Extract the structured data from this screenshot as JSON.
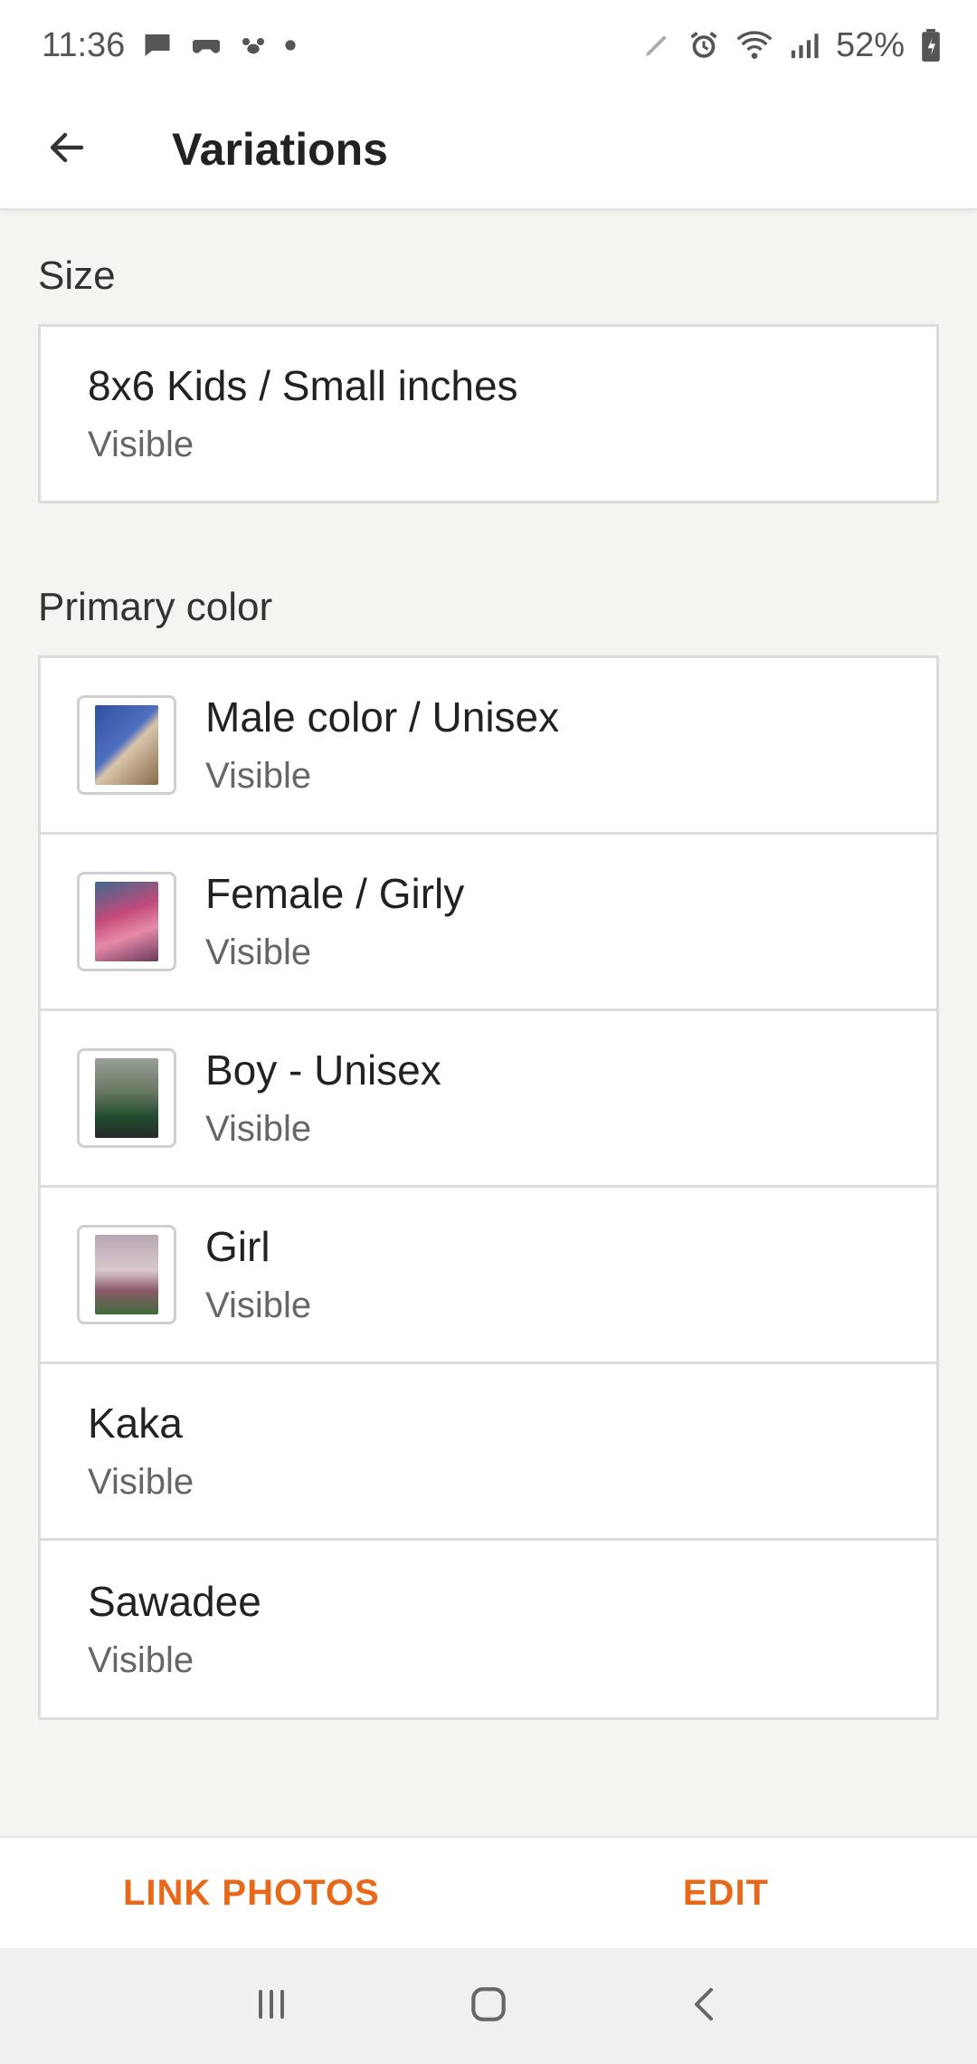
{
  "status_bar": {
    "time": "11:36",
    "battery": "52%",
    "left_icons": [
      "message-icon",
      "game-icon",
      "paw-icon",
      "dot-icon"
    ],
    "right_icons": [
      "pen-icon",
      "alarm-icon",
      "wifi-icon",
      "signal-icon",
      "battery-icon"
    ]
  },
  "app_bar": {
    "title": "Variations",
    "back_icon": "arrow-left-icon"
  },
  "sections": {
    "size": {
      "label": "Size",
      "items": [
        {
          "title": "8x6 Kids / Small inches",
          "status": "Visible"
        }
      ]
    },
    "primary_color": {
      "label": "Primary color",
      "items": [
        {
          "title": "Male color / Unisex",
          "status": "Visible",
          "thumb_colors": [
            "#2f4fa0",
            "#d7c4a8"
          ]
        },
        {
          "title": "Female / Girly",
          "status": "Visible",
          "thumb_colors": [
            "#c24a7a",
            "#3b6a8e"
          ]
        },
        {
          "title": "Boy - Unisex",
          "status": "Visible",
          "thumb_colors": [
            "#6b7a63",
            "#1f4a2e"
          ]
        },
        {
          "title": "Girl",
          "status": "Visible",
          "thumb_colors": [
            "#b8a6b2",
            "#3f6b3a"
          ]
        },
        {
          "title": "Kaka",
          "status": "Visible"
        },
        {
          "title": "Sawadee",
          "status": "Visible"
        }
      ]
    }
  },
  "actions": {
    "link_photos": "LINK PHOTOS",
    "edit": "EDIT",
    "accent_color": "#e8681a"
  },
  "nav_bar": {
    "icons": [
      "recent-apps-icon",
      "home-icon",
      "back-icon"
    ]
  }
}
